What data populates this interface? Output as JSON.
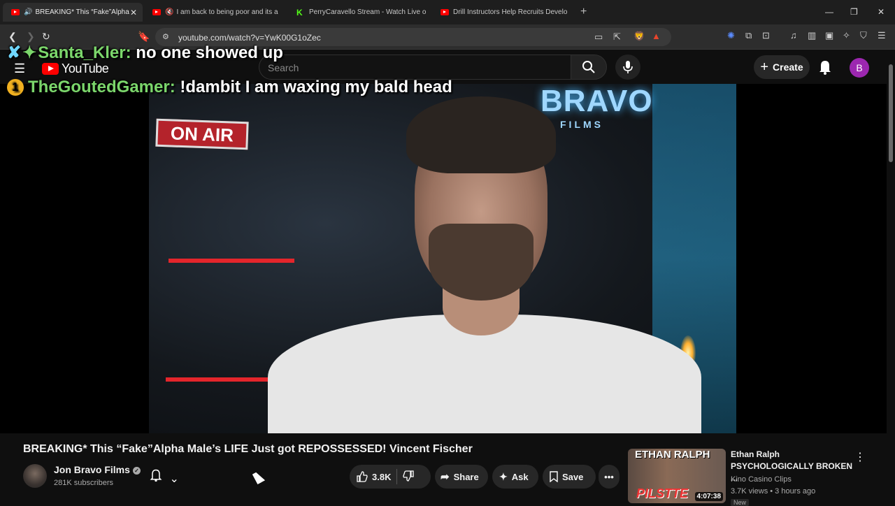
{
  "browser": {
    "tabs": [
      {
        "title": "BREAKING* This “Fake”Alpha",
        "active": true
      },
      {
        "title": "I am back to being poor and its a",
        "active": false
      },
      {
        "title": "PerryCaravello Stream - Watch Live o",
        "active": false
      },
      {
        "title": "Drill Instructors Help Recruits Develo",
        "active": false
      }
    ],
    "url": "youtube.com/watch?v=YwK00G1oZec",
    "new_tab": "+",
    "close_tab": "✕"
  },
  "youtube": {
    "logo": "YouTube",
    "search_placeholder": "Search",
    "create_label": "Create",
    "avatar_letter": "B"
  },
  "chat_overlay": [
    {
      "name": "Santa_Kler:",
      "message": "no one showed up"
    },
    {
      "badge": "1",
      "name": "TheGoutedGamer:",
      "message": "!dambit I am waxing my bald head"
    }
  ],
  "video_scene": {
    "sign": "ON AIR",
    "logo": "BRAVO",
    "logo_sub": "FILMS"
  },
  "video": {
    "title": "BREAKING* This “Fake”Alpha Male’s LIFE Just got REPOSSESSED! Vincent Fischer",
    "channel": "Jon Bravo Films",
    "subscribers": "281K subscribers",
    "likes": "3.8K",
    "share_label": "Share",
    "ask_label": "Ask",
    "save_label": "Save"
  },
  "recommendation": {
    "thumb_text": "ETHAN RALPH",
    "thumb_text2": "PILSTTE",
    "duration": "4:07:38",
    "title_line1": "Ethan Ralph",
    "title_line2": "PSYCHOLOGICALLY BROKEN ...",
    "channel": "Kino Casino Clips",
    "meta": "3.7K views • 3 hours ago",
    "badge": "New"
  }
}
